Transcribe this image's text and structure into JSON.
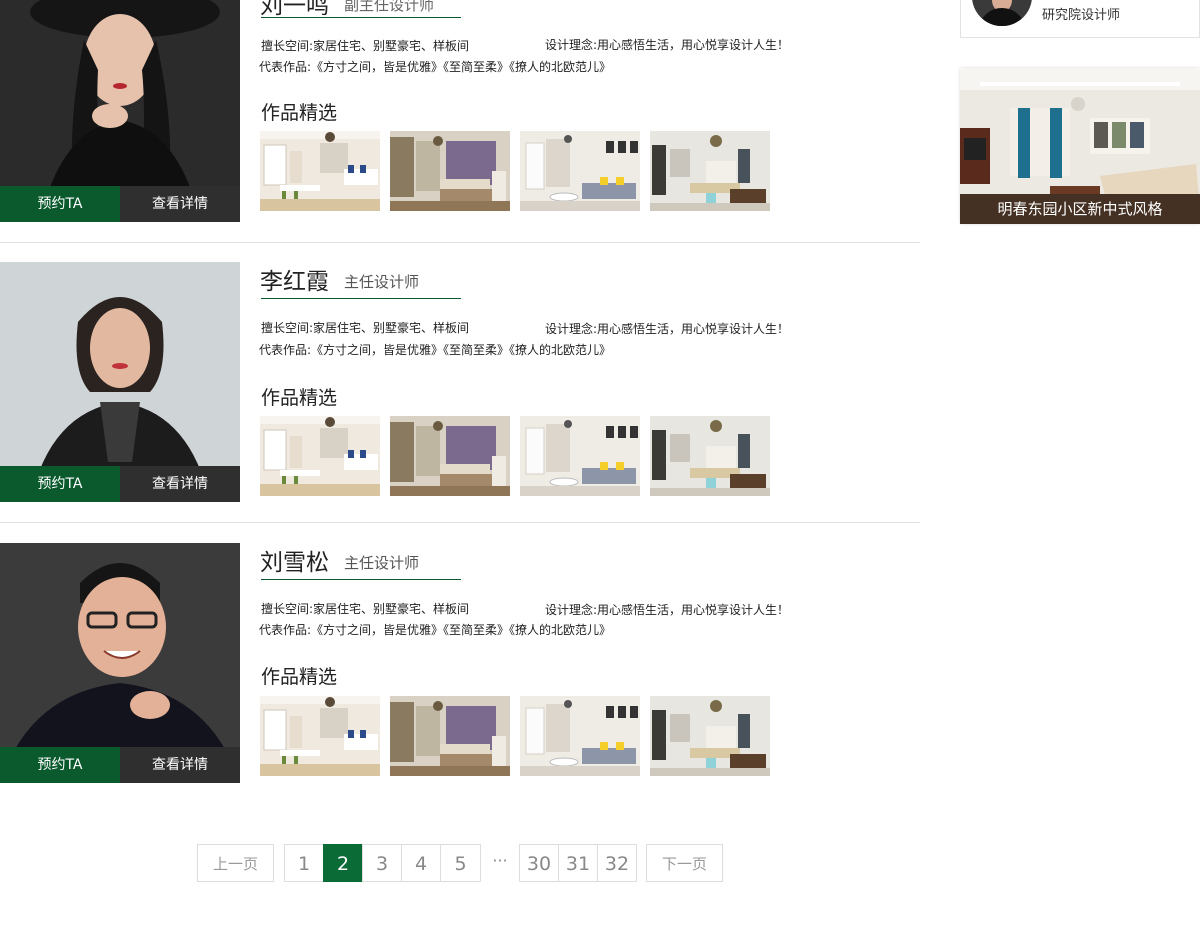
{
  "designers": [
    {
      "name": "刘一鸣",
      "title": "副主任设计师",
      "specialty": "擅长空间:家居住宅、别墅豪宅、样板间",
      "philosophy": "设计理念:用心感悟生活，用心悦享设计人生！",
      "works_text": "代表作品:《方寸之间，皆是优雅》《至简至柔》《撩人的北欧范儿》",
      "works_heading": "作品精选",
      "book_label": "预约TA",
      "detail_label": "查看详情"
    },
    {
      "name": "李红霞",
      "title": "主任设计师",
      "specialty": "擅长空间:家居住宅、别墅豪宅、样板间",
      "philosophy": "设计理念:用心感悟生活，用心悦享设计人生！",
      "works_text": "代表作品:《方寸之间，皆是优雅》《至简至柔》《撩人的北欧范儿》",
      "works_heading": "作品精选",
      "book_label": "预约TA",
      "detail_label": "查看详情"
    },
    {
      "name": "刘雪松",
      "title": "主任设计师",
      "specialty": "擅长空间:家居住宅、别墅豪宅、样板间",
      "philosophy": "设计理念:用心感悟生活，用心悦享设计人生！",
      "works_text": "代表作品:《方寸之间，皆是优雅》《至简至柔》《撩人的北欧范儿》",
      "works_heading": "作品精选",
      "book_label": "预约TA",
      "detail_label": "查看详情"
    }
  ],
  "sidebar": {
    "role": "研究院设计师",
    "feature_caption": "明春东园小区新中式风格"
  },
  "pagination": {
    "prev": "上一页",
    "next": "下一页",
    "ellipsis": "···",
    "pages": [
      "1",
      "2",
      "3",
      "4",
      "5",
      "30",
      "31",
      "32"
    ],
    "current": "2"
  },
  "colors": {
    "accent_green": "#0a5a2e",
    "active_page": "#0a6b37",
    "detail_button": "#2f2f2f"
  }
}
